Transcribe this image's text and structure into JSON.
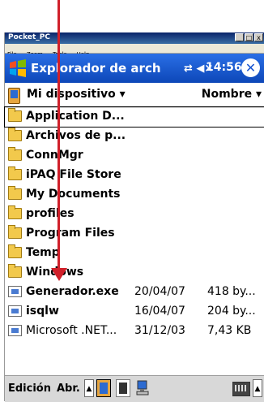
{
  "window": {
    "title": "Pocket_PC",
    "menu": [
      "File",
      "Zoom",
      "Tools",
      "Help"
    ],
    "buttons": [
      "_",
      "□",
      "x"
    ]
  },
  "navbar": {
    "title": "Explorador de arch",
    "icons": "⇄ ◀×",
    "time": "14:56",
    "close": "✕"
  },
  "header": {
    "location": "Mi dispositivo ▾",
    "sort": "Nombre ▾"
  },
  "files": [
    {
      "name": "Application D...",
      "type": "folder",
      "date": "",
      "size": "",
      "selected": true
    },
    {
      "name": "Archivos de p...",
      "type": "folder",
      "date": "",
      "size": "",
      "selected": false
    },
    {
      "name": "ConnMgr",
      "type": "folder",
      "date": "",
      "size": "",
      "selected": false
    },
    {
      "name": "iPAQ File Store",
      "type": "folder",
      "date": "",
      "size": "",
      "selected": false
    },
    {
      "name": "My Documents",
      "type": "folder",
      "date": "",
      "size": "",
      "selected": false
    },
    {
      "name": "profiles",
      "type": "folder",
      "date": "",
      "size": "",
      "selected": false
    },
    {
      "name": "Program Files",
      "type": "folder",
      "date": "",
      "size": "",
      "selected": false
    },
    {
      "name": "Temp",
      "type": "folder",
      "date": "",
      "size": "",
      "selected": false
    },
    {
      "name": "Windows",
      "type": "folder",
      "date": "",
      "size": "",
      "selected": false
    },
    {
      "name": "Generador.exe",
      "type": "file",
      "date": "20/04/07",
      "size": "418 by...",
      "selected": false
    },
    {
      "name": "isqlw",
      "type": "file",
      "date": "16/04/07",
      "size": "204 by...",
      "selected": false
    },
    {
      "name": "Microsoft .NET...",
      "type": "file",
      "date": "31/12/03",
      "size": "7,43 KB",
      "selected": false
    }
  ],
  "bottombar": {
    "edit": "Edición",
    "open": "Abr.",
    "up": "▲",
    "up2": "▲"
  },
  "colors": {
    "accent": "#1a56d1",
    "annotation_arrow": "#d0202a"
  }
}
